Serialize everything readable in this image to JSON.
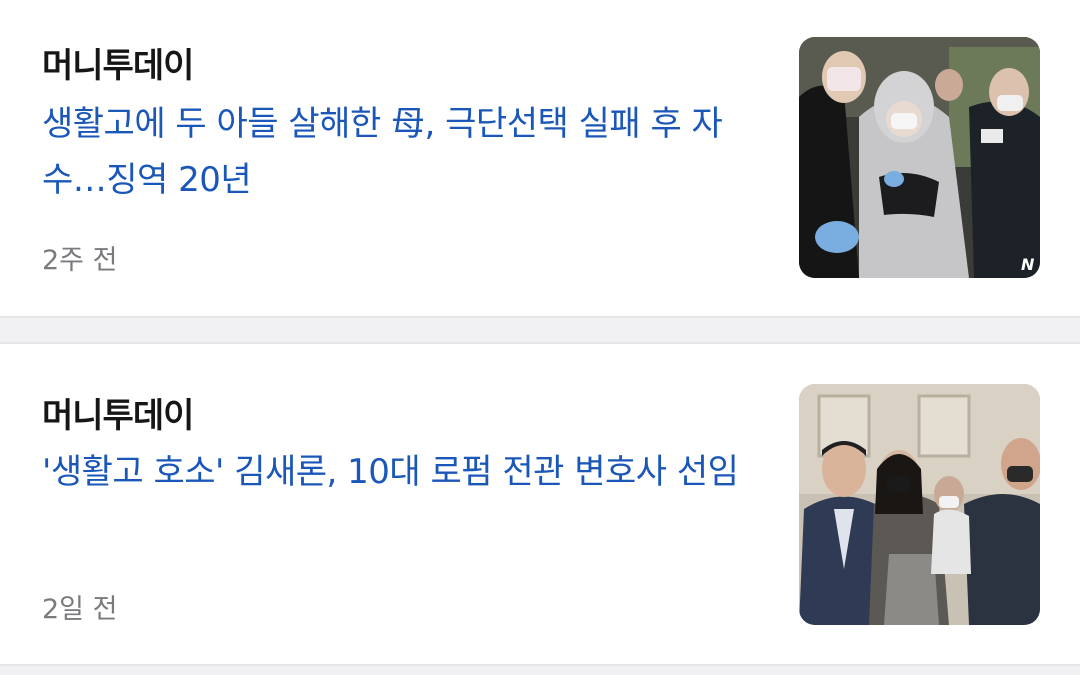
{
  "articles": [
    {
      "source": "머니투데이",
      "headline": "생활고에 두 아들 살해한 母, 극단선택 실패 후 자수…징역 20년",
      "time": "2주 전",
      "thumbnail_watermark": "N"
    },
    {
      "source": "머니투데이",
      "headline": "'생활고 호소' 김새론, 10대 로펌 전관 변호사 선임",
      "time": "2일 전"
    }
  ],
  "colors": {
    "headline": "#1a57b8",
    "source": "#161616",
    "time": "#7a7a7e",
    "divider": "#f1f1f3"
  }
}
